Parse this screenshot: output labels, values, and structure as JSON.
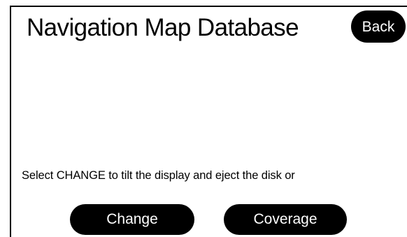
{
  "screen": {
    "title": "Navigation Map Database",
    "back_label": "Back",
    "instruction": "Select CHANGE to tilt the display and eject the disk or",
    "buttons": {
      "change_label": "Change",
      "coverage_label": "Coverage"
    }
  },
  "colors": {
    "background": "#ffffff",
    "button_fill": "#000000",
    "button_text": "#ffffff",
    "text": "#000000"
  }
}
